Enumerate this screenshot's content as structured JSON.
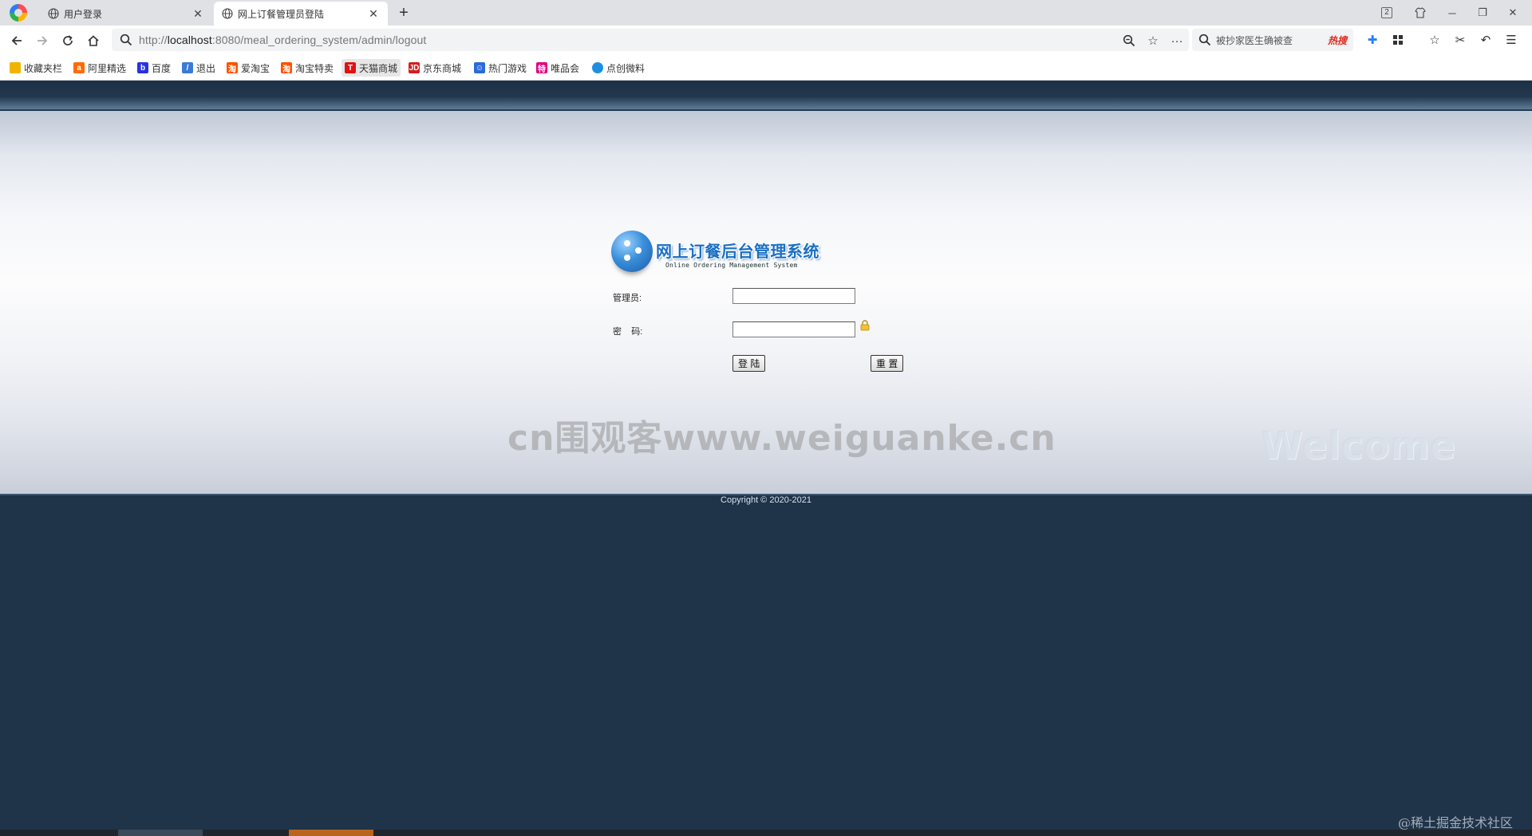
{
  "browser": {
    "tabs": [
      {
        "title": "用户登录",
        "active": false
      },
      {
        "title": "网上订餐管理员登陆",
        "active": true
      }
    ],
    "tab_count": "2",
    "url": {
      "scheme": "http://",
      "host": "localhost",
      "rest": ":8080/meal_ordering_system/admin/logout"
    },
    "search_placeholder": "被抄家医生确被查",
    "search_hot": "热搜",
    "bookmarks": [
      {
        "label": "收藏夹栏",
        "icon": "folder-icon",
        "color": "#f0b400"
      },
      {
        "label": "阿里精选",
        "icon": "ali-icon",
        "color": "#ff6a00"
      },
      {
        "label": "百度",
        "icon": "baidu-icon",
        "color": "#2932e1"
      },
      {
        "label": "退出",
        "icon": "feather-icon",
        "color": "#3a7bd5"
      },
      {
        "label": "爱淘宝",
        "icon": "taobao-icon",
        "color": "#ff5000"
      },
      {
        "label": "淘宝特卖",
        "icon": "taobao-sale-icon",
        "color": "#ff5000"
      },
      {
        "label": "天猫商城",
        "icon": "tmall-icon",
        "color": "#e01313"
      },
      {
        "label": "京东商城",
        "icon": "jd-icon",
        "color": "#d71c1e"
      },
      {
        "label": "热门游戏",
        "icon": "game-icon",
        "color": "#2a6ad9"
      },
      {
        "label": "唯品会",
        "icon": "vip-icon",
        "color": "#e4007f"
      },
      {
        "label": "点创微料",
        "icon": "dianchuang-icon",
        "color": "#1d8fe1"
      }
    ]
  },
  "login": {
    "logo_title": "网上订餐后台管理系统",
    "logo_subtitle": "Online Ordering Management System",
    "admin_label": "管理员:",
    "password_label": "密    码:",
    "admin_value": "",
    "password_value": "",
    "login_button": "登 陆",
    "reset_button": "重 置"
  },
  "watermark": "cn围观客www.weiguanke.cn",
  "welcome": "Welcome",
  "copyright": "Copyright © 2020-2021",
  "corner_credit": "@稀土掘金技术社区",
  "colors": {
    "page_bg": "#1f3349",
    "brand_blue": "#1a6fc4"
  }
}
